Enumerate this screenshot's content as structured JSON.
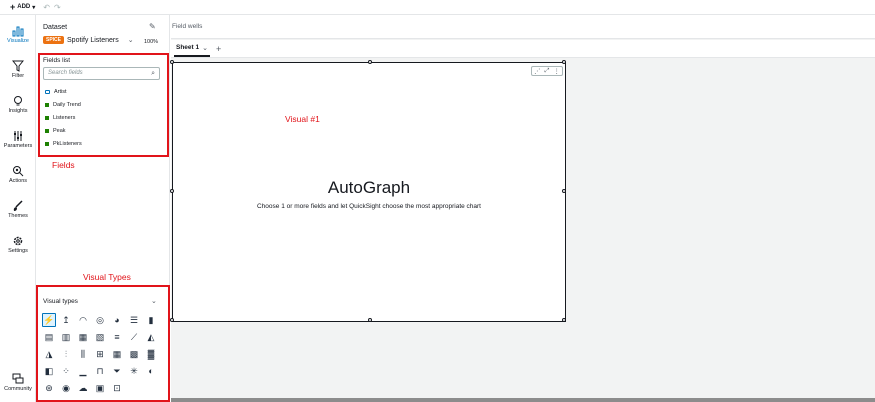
{
  "topbar": {
    "add_label": "ADD",
    "undo": "↶",
    "redo": "↷"
  },
  "rail": {
    "items": [
      {
        "label": "Visualize"
      },
      {
        "label": "Filter"
      },
      {
        "label": "Insights"
      },
      {
        "label": "Parameters"
      },
      {
        "label": "Actions"
      },
      {
        "label": "Themes"
      },
      {
        "label": "Settings"
      },
      {
        "label": "Community"
      }
    ]
  },
  "panel": {
    "dataset_label": "Dataset",
    "spice_badge": "SPICE",
    "dataset_name": "Spotify Listeners",
    "dataset_pct": "100%",
    "fields_title": "Fields list",
    "search_placeholder": "Search fields",
    "fields": [
      {
        "name": "Artist",
        "kind": "dimension"
      },
      {
        "name": "Daily Trend",
        "kind": "measure"
      },
      {
        "name": "Listeners",
        "kind": "measure"
      },
      {
        "name": "Peak",
        "kind": "measure"
      },
      {
        "name": "PkListeners",
        "kind": "measure"
      }
    ],
    "visual_types_title": "Visual types",
    "visual_type_icons": [
      "autograph-icon",
      "kpi-icon",
      "gauge-icon",
      "donut-icon",
      "pie-icon",
      "bar-icon",
      "column-icon",
      "stacked-bar-icon",
      "stacked-column-icon",
      "percent-bar-icon",
      "percent-column-icon",
      "clustered-bar-icon",
      "line-icon",
      "area-icon",
      "stacked-area-icon",
      "combo-icon",
      "combo-stacked-icon",
      "box-plot-icon",
      "pivot-icon",
      "table-icon",
      "heatmap-icon",
      "treemap-icon",
      "scatter-icon",
      "histogram-icon",
      "waterfall-icon",
      "funnel-icon",
      "radar-icon",
      "filled-map-icon",
      "points-map-icon",
      "insight-icon",
      "word-cloud-icon",
      "image-icon",
      "custom-visual-icon"
    ]
  },
  "canvas": {
    "field_wells": "Field wells",
    "sheet_tab": "Sheet 1",
    "autograph_title": "AutoGraph",
    "autograph_subtitle": "Choose 1 or more fields and let QuickSight choose the most appropriate chart"
  },
  "annotations": {
    "fields": "Fields",
    "visual_types": "Visual Types",
    "visual": "Visual #1"
  },
  "colors": {
    "accent": "#0073bb",
    "annotation": "#e1141a",
    "spice": "#ec7211"
  }
}
